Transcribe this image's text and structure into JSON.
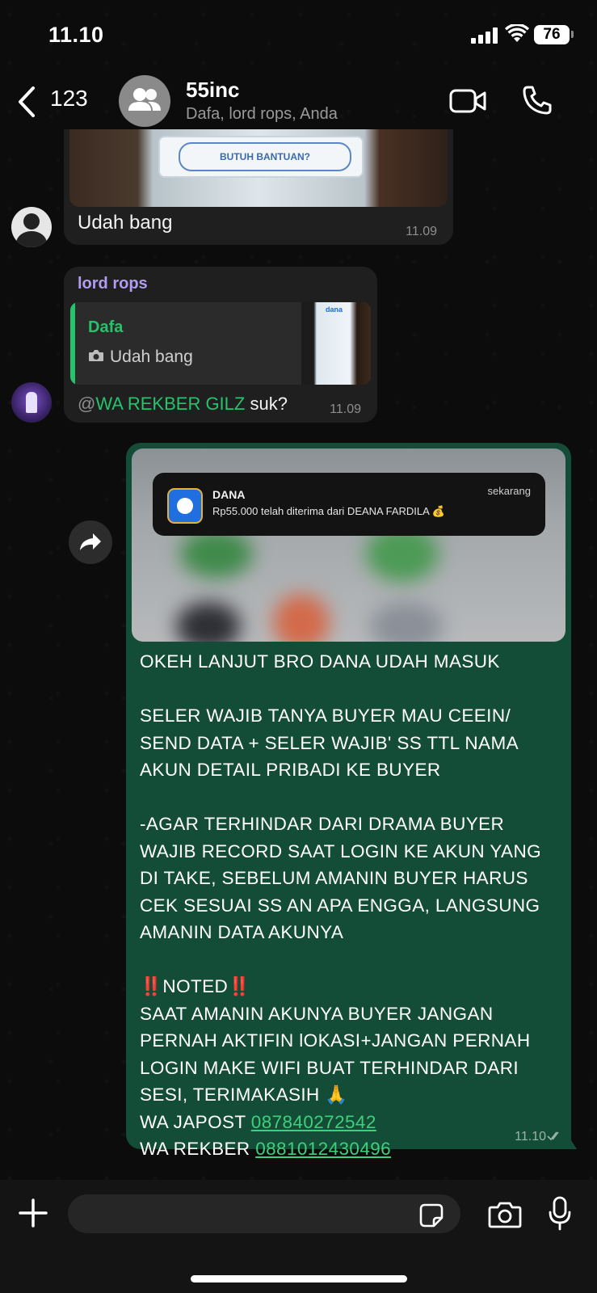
{
  "status_bar": {
    "time": "11.10",
    "battery": "76"
  },
  "header": {
    "back_count": "123",
    "group_name": "55inc",
    "members": "Dafa, lord rops, Anda"
  },
  "messages": [
    {
      "image_button_text": "BUTUH BANTUAN?",
      "text": "Udah bang",
      "time": "11.09"
    },
    {
      "sender": "lord rops",
      "quote": {
        "name": "Dafa",
        "text": "Udah bang",
        "thumb_logo": "dana"
      },
      "mention_at": "@",
      "mention_name": "WA REKBER GILZ",
      "text_after": " suk?",
      "time": "11.09"
    },
    {
      "notification": {
        "app": "DANA",
        "body": "Rp55.000 telah diterima dari DEANA FARDILA 💰",
        "time": "sekarang"
      },
      "paragraphs": [
        "OKEH LANJUT BRO DANA UDAH MASUK",
        "SELER WAJIB TANYA BUYER MAU CEEIN/ SEND DATA + SELER WAJIB' SS TTL NAMA AKUN DETAIL PRIBADI KE BUYER",
        "-AGAR TERHINDAR DARI DRAMA BUYER WAJIB RECORD SAAT LOGIN KE AKUN YANG DI TAKE, SEBELUM AMANIN BUYER HARUS CEK SESUAI SS AN APA ENGGA, LANGSUNG AMANIN DATA AKUNYA"
      ],
      "noted": "‼️NOTED‼️",
      "noted_text": "SAAT AMANIN AKUNYA BUYER JANGAN PERNAH AKTIFIN lOKASI+JANGAN PERNAH LOGIN MAKE WIFI BUAT TERHINDAR DARI SESI, TERIMAKASIH 🙏",
      "japost_label": "WA JAPOST ",
      "japost_number": "087840272542",
      "rekber_label": "WA REKBER ",
      "rekber_number": "0881012430496",
      "time": "11.10"
    }
  ],
  "input": {
    "placeholder": ""
  },
  "colors": {
    "accent_green": "#25c36b",
    "outgoing_bubble": "#144d37",
    "incoming_bubble": "#1f1f1f",
    "sender_purple": "#b09cf0"
  }
}
